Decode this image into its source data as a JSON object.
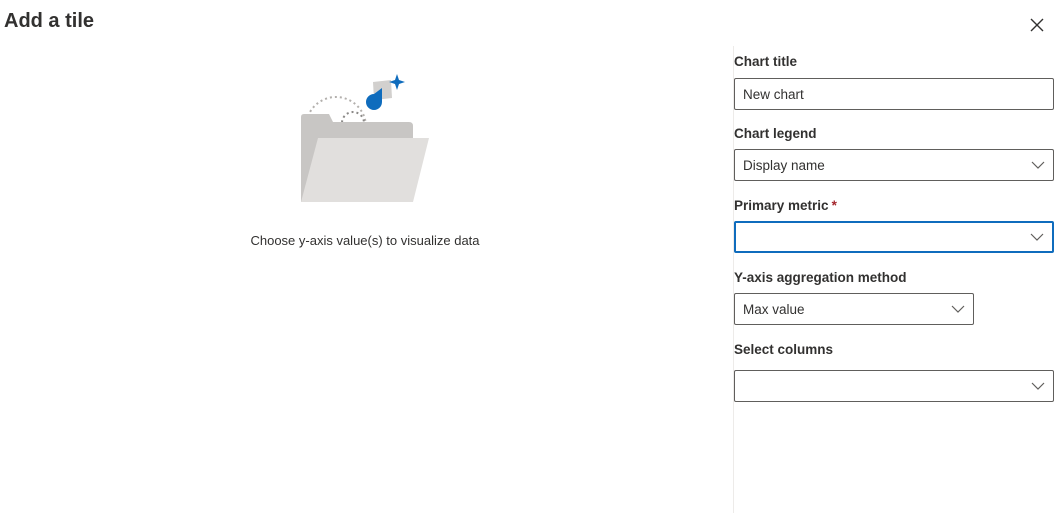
{
  "dialog": {
    "title": "Add a tile"
  },
  "empty_state": {
    "message": "Choose y-axis value(s) to visualize data"
  },
  "form": {
    "chart_title": {
      "label": "Chart title",
      "value": "New chart"
    },
    "chart_legend": {
      "label": "Chart legend",
      "value": "Display name"
    },
    "primary_metric": {
      "label": "Primary metric",
      "required_marker": "*",
      "value": ""
    },
    "aggregation": {
      "label": "Y-axis aggregation method",
      "value": "Max value"
    },
    "select_columns": {
      "label": "Select columns",
      "value": ""
    }
  },
  "icons": {
    "close": "close-icon",
    "dropdown": "chevron-down-icon",
    "illustration": "folder-chart-illustration"
  },
  "colors": {
    "accent": "#0f6cbd",
    "required": "#a4262c",
    "border": "#605e5c",
    "text": "#323130"
  }
}
